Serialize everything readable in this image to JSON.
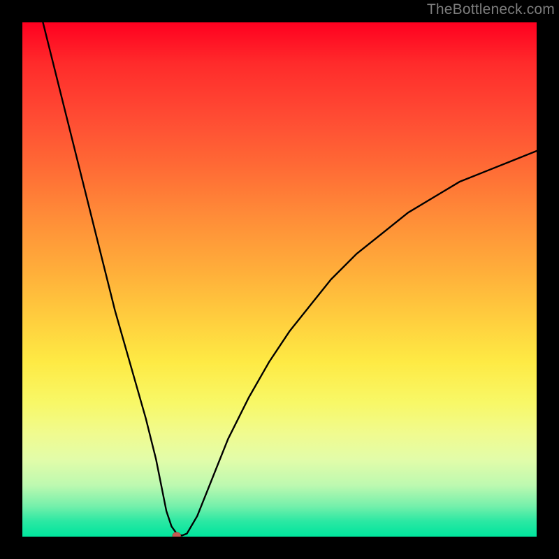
{
  "watermark": "TheBottleneck.com",
  "chart_data": {
    "type": "line",
    "title": "",
    "xlabel": "",
    "ylabel": "",
    "xlim": [
      0,
      100
    ],
    "ylim": [
      0,
      100
    ],
    "grid": false,
    "series": [
      {
        "name": "bottleneck-curve",
        "x": [
          4,
          6,
          8,
          10,
          12,
          14,
          16,
          18,
          20,
          22,
          24,
          26,
          27,
          28,
          29,
          30,
          31,
          32,
          34,
          36,
          38,
          40,
          44,
          48,
          52,
          56,
          60,
          65,
          70,
          75,
          80,
          85,
          90,
          95,
          100
        ],
        "values": [
          100,
          92,
          84,
          76,
          68,
          60,
          52,
          44,
          37,
          30,
          23,
          15,
          10,
          5,
          2,
          0.6,
          0.2,
          0.6,
          4,
          9,
          14,
          19,
          27,
          34,
          40,
          45,
          50,
          55,
          59,
          63,
          66,
          69,
          71,
          73,
          75
        ]
      }
    ],
    "marker": {
      "x": 30,
      "y": 0.2,
      "color": "#c45a52"
    },
    "background_gradient": {
      "direction": "vertical",
      "stops": [
        {
          "pos": 0.0,
          "color": "#ff0020"
        },
        {
          "pos": 0.5,
          "color": "#ffc03c"
        },
        {
          "pos": 0.75,
          "color": "#f8f867"
        },
        {
          "pos": 1.0,
          "color": "#00e59d"
        }
      ]
    }
  }
}
